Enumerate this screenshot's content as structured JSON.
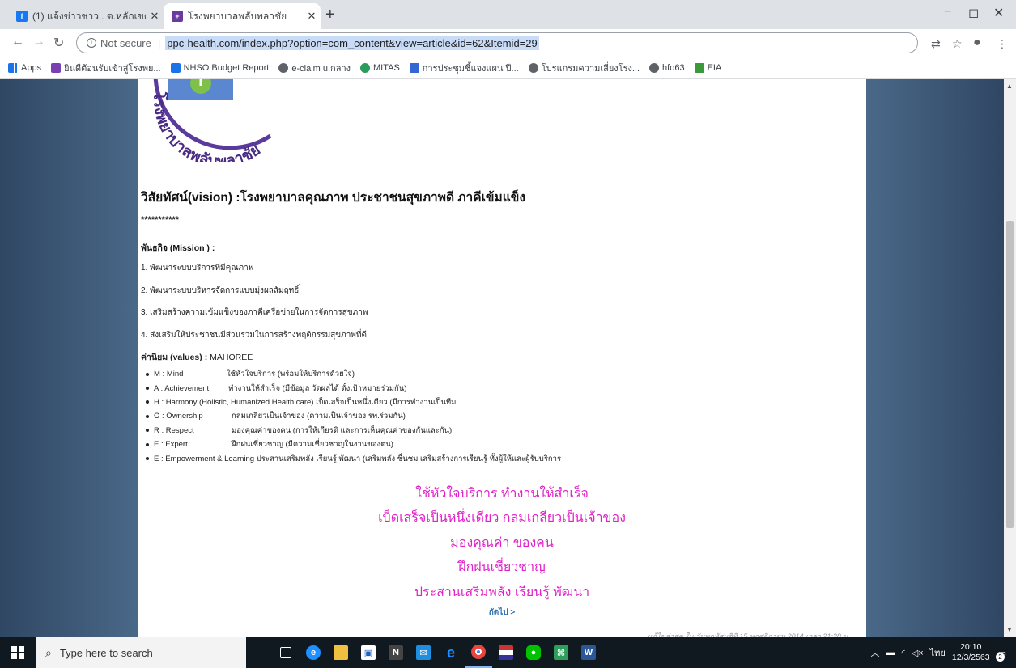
{
  "browser": {
    "tabs": [
      {
        "title": "(1) แจ้งข่าวชาว.. ต.หลักเขต",
        "icon": "facebook-icon",
        "active": false
      },
      {
        "title": "โรงพยาบาลพลับพลาชัย",
        "icon": "hospital-favicon",
        "active": true
      }
    ],
    "new_tab": "+",
    "minimize": "−",
    "maximize": "◻",
    "close": "✕",
    "security": "Not secure",
    "url": "ppc-health.com/index.php?option=com_content&view=article&id=62&Itemid=29",
    "bookmarks": [
      {
        "label": "Apps",
        "icon": "apps-grid-icon"
      },
      {
        "label": "ยินดีต้อนรับเข้าสู่โรงพย...",
        "icon": "hospital-icon"
      },
      {
        "label": "NHSO Budget Report",
        "icon": "chart-icon"
      },
      {
        "label": "e-claim u.กลาง",
        "icon": "globe-icon"
      },
      {
        "label": "MITAS",
        "icon": "mitas-icon"
      },
      {
        "label": "การประชุมชี้แจงแผน ปี...",
        "icon": "calendar-icon"
      },
      {
        "label": "โปรแกรมความเสี่ยงโรง...",
        "icon": "globe-icon"
      },
      {
        "label": "hfo63",
        "icon": "globe-icon"
      },
      {
        "label": "EIA",
        "icon": "eia-icon"
      }
    ]
  },
  "page": {
    "logo_text": "โรงพยาบาลพลับพลาชัย",
    "vision": "วิสัยทัศน์(vision) :โรงพยาบาลคุณภาพ ประชาชนสุขภาพดี ภาคีเข้มแข็ง",
    "stars": "***********",
    "mission_heading": "พันธกิจ (Mission ) :",
    "missions": [
      "1. พัฒนาระบบบริการที่มีคุณภาพ",
      "2. พัฒนาระบบบริหารจัดการแบบมุ่งผลสัมฤทธิ์",
      "3. เสริมสร้างความเข้มแข็งของภาคีเครือข่ายในการจัดการสุขภาพ",
      "4. ส่งเสริมให้ประชาชนมีส่วนร่วมในการสร้างพฤติกรรมสุขภาพที่ดี"
    ],
    "values_heading": "ค่านิยม (values) :",
    "values_word": " MAHOREE",
    "values": [
      {
        "code": "M : Mind",
        "desc": "ใช้หัวใจบริการ (พร้อมให้บริการด้วยใจ)"
      },
      {
        "code": "A : Achievement",
        "desc": "ทำงานให้สำเร็จ (มีข้อมูล วัดผลได้ ตั้งเป้าหมายร่วมกัน)"
      },
      {
        "code": "H : Harmony (Holistic, Humanized Health care)",
        "desc": "เบ็ดเสร็จเป็นหนึ่งเดียว (มีการทำงานเป็นทีม"
      },
      {
        "code": "O : Ownership",
        "desc": "กลมเกลียวเป็นเจ้าของ (ความเป็นเจ้าของ รพ.ร่วมกัน)"
      },
      {
        "code": "R : Respect",
        "desc": "มองคุณค่าของคน (การให้เกียรติ และการเห็นคุณค่าของกันและกัน)"
      },
      {
        "code": "E : Expert",
        "desc": "ฝึกฝนเชี่ยวชาญ (มีความเชี่ยวชาญในงานของตน)"
      },
      {
        "code": "E : Empowerment & Learning",
        "desc": "ประสานเสริมพลัง เรียนรู้ พัฒนา (เสริมพลัง ชื่นชม เสริมสร้างการเรียนรู้ ทั้งผู้ให้และผู้รับบริการ"
      }
    ],
    "slogans": [
      "ใช้หัวใจบริการ ทำงานให้สำเร็จ",
      "เบ็ดเสร็จเป็นหนึ่งเดียว กลมเกลียวเป็นเจ้าของ",
      "มองคุณค่า ของคน",
      "ฝึกฝนเชี่ยวชาญ",
      "ประสานเสริมพลัง เรียนรู้ พัฒนา"
    ],
    "next_link": "ถัดไป >",
    "updated_partial": "แก้ไขล่าสุด ใน วันพฤหัสบดีที่ 15 พฤศจิกายน 2014 เวลา 21:28 น."
  },
  "taskbar": {
    "search_placeholder": "Type here to search",
    "apps": [
      "task-view-icon",
      "edge-icon",
      "file-explorer-icon",
      "store-icon",
      "onenote-icon",
      "mail-icon",
      "ie-icon",
      "chrome-icon",
      "flag-app-icon",
      "line-icon",
      "excel-like-icon",
      "word-icon"
    ],
    "lang": "ไทย",
    "time": "20:10",
    "date": "12/3/2563",
    "notif_count": "2"
  },
  "colors": {
    "slogan": "#e020c8",
    "side_bg": "#3b5674",
    "link": "#3070b0"
  }
}
